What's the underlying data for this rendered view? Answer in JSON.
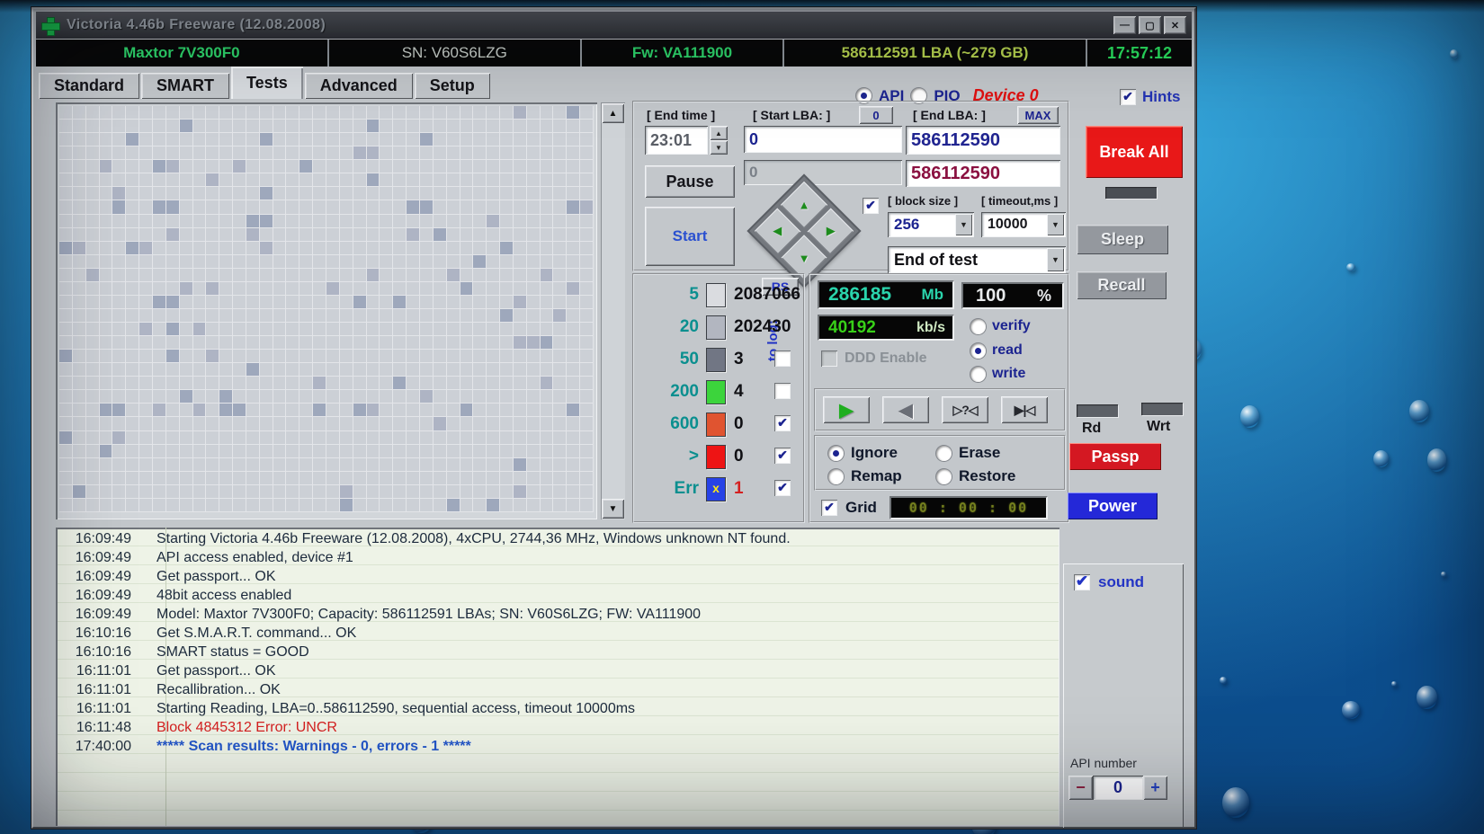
{
  "window": {
    "title": "Victoria 4.46b Freeware (12.08.2008)"
  },
  "window_buttons": {
    "minimize": "—",
    "maximize": "▢",
    "close": "✕"
  },
  "infobar": {
    "model": "Maxtor 7V300F0",
    "sn": "SN: V60S6LZG",
    "fw": "Fw: VA111900",
    "lba": "586112591 LBA (~279 GB)",
    "clock": "17:57:12"
  },
  "tabs": [
    {
      "label": "Standard",
      "active": false
    },
    {
      "label": "SMART",
      "active": false
    },
    {
      "label": "Tests",
      "active": true
    },
    {
      "label": "Advanced",
      "active": false
    },
    {
      "label": "Setup",
      "active": false
    }
  ],
  "mode": {
    "api": "API",
    "pio": "PIO",
    "device": "Device 0",
    "hints": "Hints"
  },
  "controls": {
    "end_time_label": "[ End time ]",
    "end_time_value": "23:01",
    "start_lba_label": "[ Start LBA: ]",
    "start_lba_button": "0",
    "start_lba_value": "0",
    "current_lba_value": "0",
    "end_lba_label": "[ End LBA: ]",
    "max_button": "MAX",
    "end_lba_value": "586112590",
    "end_lba_current": "586112590",
    "pause_button": "Pause",
    "start_button": "Start",
    "block_size_label": "[ block size ]",
    "block_size_value": "256",
    "timeout_label": "[ timeout,ms ]",
    "timeout_value": "10000",
    "end_of_test_value": "End of test"
  },
  "timing": {
    "rs_button": "RS",
    "to_log_label": "to log:",
    "rows": [
      {
        "label": "5",
        "value": "2087066",
        "color": "#dadce0",
        "striped": false,
        "checkbox": "none",
        "err": false
      },
      {
        "label": "20",
        "value": "202430",
        "color": "#b2b6c0",
        "striped": false,
        "checkbox": "none",
        "err": false
      },
      {
        "label": "50",
        "value": "3",
        "color": "#717684",
        "striped": false,
        "checkbox": "unchecked",
        "err": false
      },
      {
        "label": "200",
        "value": "4",
        "color": "#3cd43c",
        "striped": true,
        "checkbox": "unchecked",
        "err": false
      },
      {
        "label": "600",
        "value": "0",
        "color": "#e05430",
        "striped": true,
        "checkbox": "checked",
        "err": false
      },
      {
        "label": ">",
        "value": "0",
        "color": "#ee1414",
        "striped": false,
        "checkbox": "checked",
        "err": false
      },
      {
        "label": "Err",
        "value": "1",
        "color": "#2742e6",
        "striped": false,
        "checkbox": "checked",
        "err": true
      }
    ]
  },
  "monitor": {
    "mb_value": "286185",
    "mb_unit": "Mb",
    "percent_value": "100",
    "percent_unit": "%",
    "speed_value": "40192",
    "speed_unit": "kb/s",
    "ddd_label": "DDD Enable",
    "verify": "verify",
    "read": "read",
    "write": "write"
  },
  "player": {
    "play": "▶",
    "rew": "◀",
    "scan": "▷?◁",
    "skip": "▶|◁"
  },
  "actions": {
    "ignore": "Ignore",
    "erase": "Erase",
    "remap": "Remap",
    "restore": "Restore",
    "grid": "Grid",
    "timer": "00 : 00 : 00"
  },
  "side": {
    "break_all": "Break All",
    "sleep": "Sleep",
    "recall": "Recall",
    "rd": "Rd",
    "wrt": "Wrt",
    "passp": "Passp",
    "power": "Power"
  },
  "bottom": {
    "sound": "sound",
    "api_number_label": "API number",
    "minus": "−",
    "value": "0",
    "plus": "+"
  },
  "icons": {
    "spin_up": "▲",
    "spin_down": "▼",
    "dropdown": "▼",
    "scroll_up": "▲",
    "scroll_down": "▼",
    "diamond_up": "▲",
    "diamond_down": "▼",
    "diamond_left": "◀",
    "diamond_right": "▶"
  },
  "log": {
    "entries": [
      {
        "time": "16:09:49",
        "text": "Starting Victoria 4.46b Freeware (12.08.2008), 4xCPU, 2744,36 MHz, Windows unknown NT found.",
        "kind": "normal"
      },
      {
        "time": "16:09:49",
        "text": "API access enabled, device #1",
        "kind": "normal"
      },
      {
        "time": "16:09:49",
        "text": "Get passport... OK",
        "kind": "normal"
      },
      {
        "time": "16:09:49",
        "text": "48bit access enabled",
        "kind": "normal"
      },
      {
        "time": "16:09:49",
        "text": "Model: Maxtor 7V300F0; Capacity: 586112591 LBAs; SN: V60S6LZG; FW: VA111900",
        "kind": "normal"
      },
      {
        "time": "16:10:16",
        "text": "Get S.M.A.R.T. command... OK",
        "kind": "normal"
      },
      {
        "time": "16:10:16",
        "text": "SMART status = GOOD",
        "kind": "normal"
      },
      {
        "time": "16:11:01",
        "text": "Get passport... OK",
        "kind": "normal"
      },
      {
        "time": "16:11:01",
        "text": "Recallibration... OK",
        "kind": "normal"
      },
      {
        "time": "16:11:01",
        "text": "Starting Reading, LBA=0..586112590, sequential access, timeout 10000ms",
        "kind": "normal"
      },
      {
        "time": "16:11:48",
        "text": "Block 4845312 Error: UNCR",
        "kind": "error"
      },
      {
        "time": "17:40:00",
        "text": "***** Scan results: Warnings - 0, errors - 1 *****",
        "kind": "result"
      }
    ]
  },
  "scan_grid": {
    "cols": 40,
    "rows": 30
  },
  "colors": {
    "title_green": "#2ed46a",
    "lba_yellow": "#b6d24e",
    "clock_green": "#2ae05e",
    "break_red": "#e81818",
    "passp_red": "#d41822",
    "power_blue": "#2428d8",
    "display_teal": "#2ad4ac",
    "display_green": "#38d018",
    "device_red": "#e01010",
    "error_red": "#d42020",
    "result_blue": "#2356c8",
    "desktop_blue": "#1668a6"
  }
}
